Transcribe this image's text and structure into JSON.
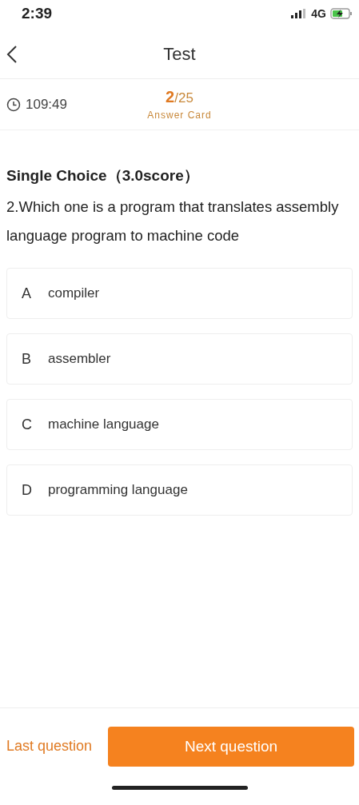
{
  "status_bar": {
    "time": "2:39",
    "network": "4G"
  },
  "nav": {
    "title": "Test"
  },
  "info": {
    "timer": "109:49",
    "current": "2",
    "total": "/25",
    "answer_card": "Answer Card"
  },
  "question": {
    "type": "Single Choice（3.0score）",
    "text": "2.Which one is a program that translates assembly language program to machine code"
  },
  "options": [
    {
      "letter": "A",
      "text": "compiler",
      "selected": false
    },
    {
      "letter": "B",
      "text": "assembler",
      "selected": false
    },
    {
      "letter": "C",
      "text": "machine language",
      "selected": false
    },
    {
      "letter": "D",
      "text": "programming language",
      "selected": false
    }
  ],
  "footer": {
    "prev": "Last question",
    "next": "Next question"
  }
}
